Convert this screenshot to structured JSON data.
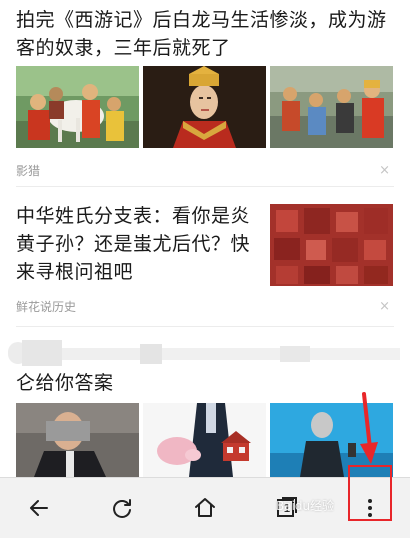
{
  "feed": {
    "articles": [
      {
        "title": "拍完《西游记》后白龙马生活惨淡，成为游客的奴隶，三年后就死了",
        "source": "影猎",
        "dismiss": "×"
      },
      {
        "title": "中华姓氏分支表：看你是炎黄子孙？还是蚩尤后代？快来寻根问祖吧",
        "source": "鲜花说历史",
        "dismiss": "×"
      },
      {
        "title": "仑给你答案"
      }
    ]
  },
  "toolbar": {
    "tab_count": "1",
    "icons": [
      "back-arrow-icon",
      "refresh-icon",
      "home-icon",
      "tabs-icon",
      "more-vertical-icon"
    ]
  },
  "watermark": "Baidu经验",
  "colors": {
    "annotation_red": "#e8262a",
    "toolbar_bg": "#f2f2f2",
    "source_gray": "#9a9a9a"
  }
}
